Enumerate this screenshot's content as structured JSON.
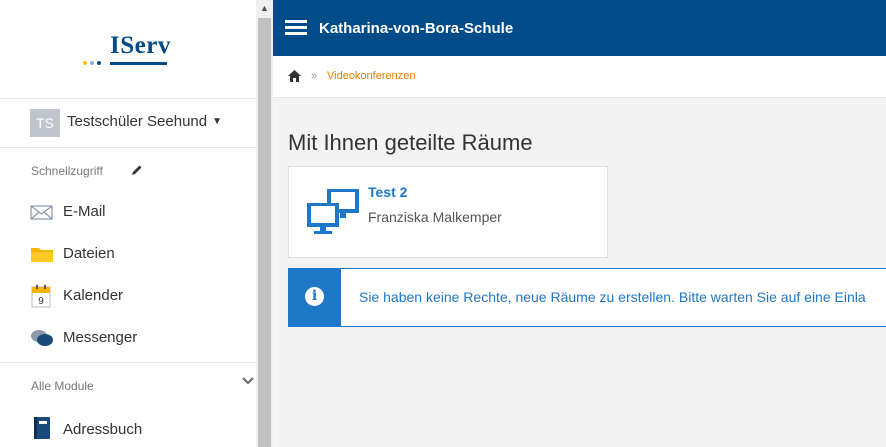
{
  "sidebar": {
    "logo_text": "IServ",
    "logo_dot_colors": [
      "#f5c400",
      "#8fb3d9",
      "#004b88"
    ],
    "user": {
      "initials": "TS",
      "name": "Testschüler Seehund"
    },
    "quick_access_label": "Schnellzugriff",
    "quick_items": [
      {
        "label": "E-Mail",
        "icon": "mail-icon"
      },
      {
        "label": "Dateien",
        "icon": "folder-icon"
      },
      {
        "label": "Kalender",
        "icon": "calendar-icon",
        "day": "9"
      },
      {
        "label": "Messenger",
        "icon": "chat-icon"
      }
    ],
    "all_modules_label": "Alle Module",
    "modules": [
      {
        "label": "Adressbuch",
        "icon": "address-book-icon"
      }
    ]
  },
  "header": {
    "title": "Katharina-von-Bora-Schule"
  },
  "breadcrumb": {
    "separator": "»",
    "current": "Videokonferenzen"
  },
  "main": {
    "heading": "Mit Ihnen geteilte Räume",
    "rooms": [
      {
        "name": "Test 2",
        "owner": "Franziska Malkemper"
      }
    ],
    "alert_text": "Sie haben keine Rechte, neue Räume zu erstellen. Bitte warten Sie auf eine Einla"
  },
  "colors": {
    "brand": "#004b88",
    "accent": "#1f77c7",
    "link": "#e67e00"
  }
}
